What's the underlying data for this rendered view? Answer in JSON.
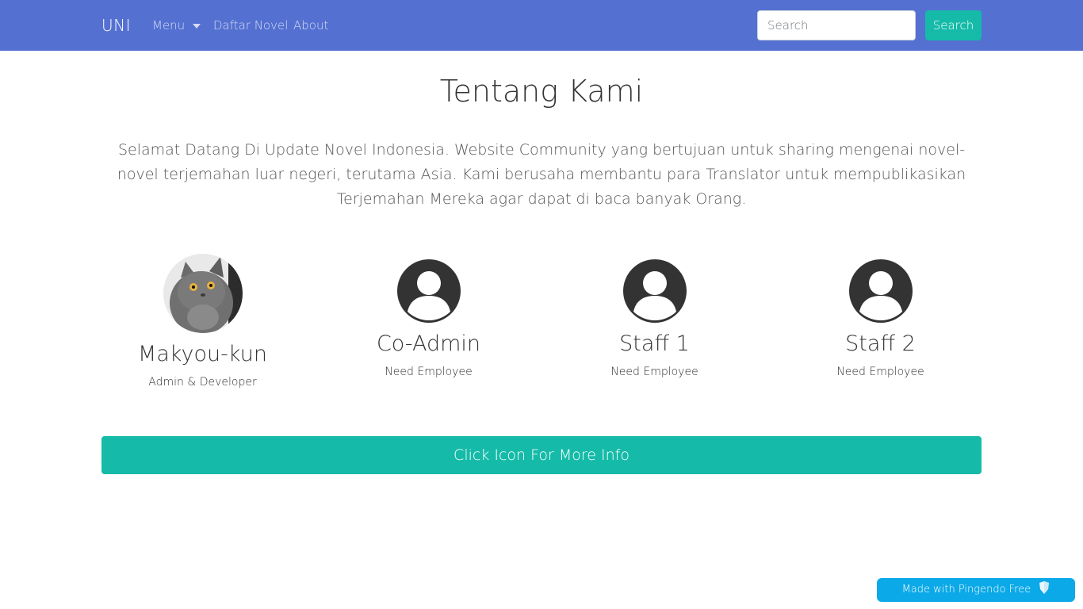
{
  "navbar": {
    "brand": "UNI",
    "menu_label": "Menu",
    "daftar_label": "Daftar Novel",
    "about_label": "About",
    "search_placeholder": "Search",
    "search_button": "Search"
  },
  "main": {
    "title": "Tentang Kami",
    "intro": "Selamat Datang Di Update Novel Indonesia. Website Community yang bertujuan untuk sharing mengenai novel-novel terjemahan luar negeri, terutama Asia. Kami berusaha membantu para Translator untuk mempublikasikan Terjemahan Mereka agar dapat di baca banyak Orang.",
    "members": [
      {
        "name": "Makyou-kun",
        "role": "Admin & Developer",
        "icon": "cat-photo"
      },
      {
        "name": "Co-Admin",
        "role": "Need Employee",
        "icon": "user-circle-icon"
      },
      {
        "name": "Staff 1",
        "role": "Need Employee",
        "icon": "user-circle-icon"
      },
      {
        "name": "Staff 2",
        "role": "Need Employee",
        "icon": "user-circle-icon"
      }
    ],
    "info_button": "Click Icon For More Info"
  },
  "badge": {
    "label": "Made with Pingendo Free"
  },
  "colors": {
    "navbar": "#5470d1",
    "accent": "#15bba8",
    "badge": "#0ba9e8"
  }
}
